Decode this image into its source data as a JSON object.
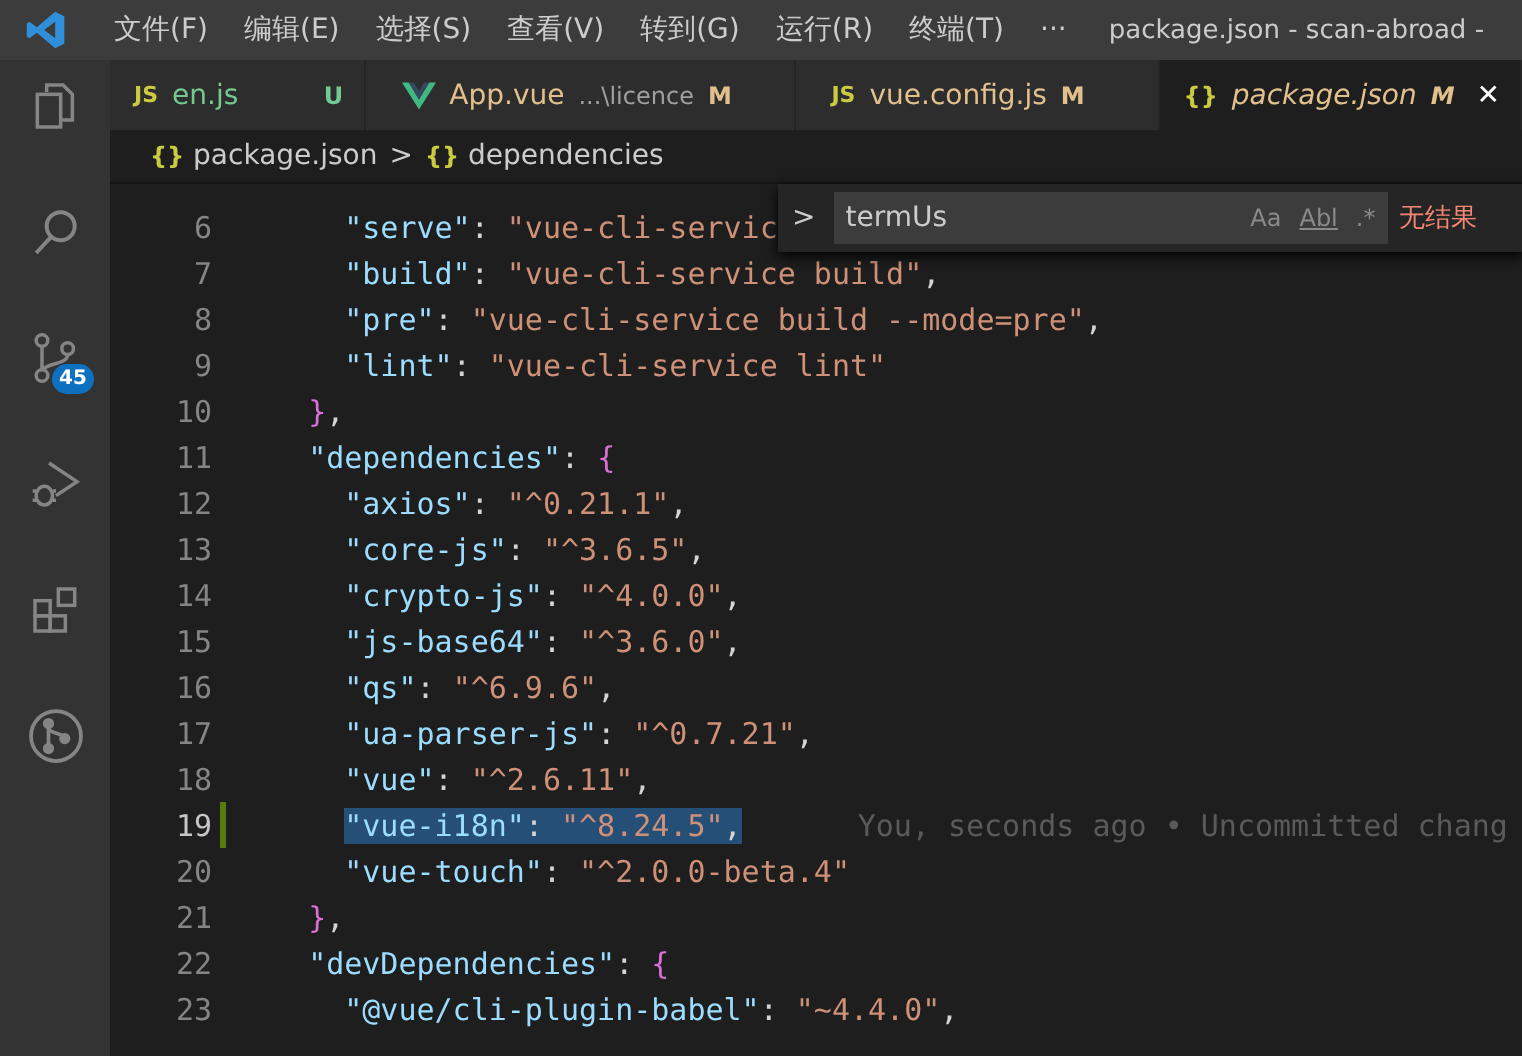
{
  "title_bar": {
    "menus": [
      "文件(F)",
      "编辑(E)",
      "选择(S)",
      "查看(V)",
      "转到(G)",
      "运行(R)",
      "终端(T)"
    ],
    "more": "···",
    "title": "package.json - scan-abroad -"
  },
  "activity_bar": [
    {
      "kind": "explorer",
      "selected": false
    },
    {
      "kind": "search",
      "selected": false
    },
    {
      "kind": "source-control",
      "selected": false,
      "badge": "45"
    },
    {
      "kind": "debug",
      "selected": false
    },
    {
      "kind": "extensions",
      "selected": false
    },
    {
      "kind": "git-graph",
      "selected": false
    }
  ],
  "tabs": [
    {
      "kind": "js",
      "icon": "JS",
      "label": "en.js",
      "status": "U",
      "selected": false
    },
    {
      "kind": "vue",
      "label": "App.vue",
      "detail": "...\\licence",
      "status": "M",
      "selected": false
    },
    {
      "kind": "js",
      "icon": "JS",
      "label": "vue.config.js",
      "status": "M",
      "selected": false
    },
    {
      "kind": "json",
      "icon": "{}",
      "label": "package.json",
      "status": "M",
      "close": "✕",
      "selected": true
    }
  ],
  "breadcrumb": [
    {
      "icon": "{}",
      "label": "package.json"
    },
    {
      "icon": "{}",
      "label": "dependencies"
    }
  ],
  "breadcrumb_separator": ">",
  "find_widget": {
    "toggle": ">",
    "value": "termUs",
    "options": [
      "Aa",
      "Abl",
      ".*"
    ],
    "result": "无结果"
  },
  "lines": [
    {
      "number": "6",
      "modified": false,
      "current": false,
      "selected": false,
      "tokens": [
        {
          "kind": "key",
          "text": "    \"serve\""
        },
        {
          "kind": "punct",
          "text": ": "
        },
        {
          "kind": "str",
          "text": "\"vue-cli-servic"
        }
      ]
    },
    {
      "number": "7",
      "modified": false,
      "current": false,
      "selected": false,
      "tokens": [
        {
          "kind": "key",
          "text": "    \"build\""
        },
        {
          "kind": "punct",
          "text": ": "
        },
        {
          "kind": "str",
          "text": "\"vue-cli-service build\""
        },
        {
          "kind": "punct",
          "text": ","
        }
      ]
    },
    {
      "number": "8",
      "modified": false,
      "current": false,
      "selected": false,
      "tokens": [
        {
          "kind": "key",
          "text": "    \"pre\""
        },
        {
          "kind": "punct",
          "text": ": "
        },
        {
          "kind": "str",
          "text": "\"vue-cli-service build --mode=pre\""
        },
        {
          "kind": "punct",
          "text": ","
        }
      ]
    },
    {
      "number": "9",
      "modified": false,
      "current": false,
      "selected": false,
      "tokens": [
        {
          "kind": "key",
          "text": "    \"lint\""
        },
        {
          "kind": "punct",
          "text": ": "
        },
        {
          "kind": "str",
          "text": "\"vue-cli-service lint\""
        }
      ]
    },
    {
      "number": "10",
      "modified": false,
      "current": false,
      "selected": false,
      "tokens": [
        {
          "kind": "bracket",
          "text": "  }"
        },
        {
          "kind": "punct",
          "text": ","
        }
      ]
    },
    {
      "number": "11",
      "modified": false,
      "current": false,
      "selected": false,
      "tokens": [
        {
          "kind": "key",
          "text": "  \"dependencies\""
        },
        {
          "kind": "punct",
          "text": ": "
        },
        {
          "kind": "bracket",
          "text": "{"
        }
      ]
    },
    {
      "number": "12",
      "modified": false,
      "current": false,
      "selected": false,
      "tokens": [
        {
          "kind": "key",
          "text": "    \"axios\""
        },
        {
          "kind": "punct",
          "text": ": "
        },
        {
          "kind": "str",
          "text": "\"^0.21.1\""
        },
        {
          "kind": "punct",
          "text": ","
        }
      ]
    },
    {
      "number": "13",
      "modified": false,
      "current": false,
      "selected": false,
      "tokens": [
        {
          "kind": "key",
          "text": "    \"core-js\""
        },
        {
          "kind": "punct",
          "text": ": "
        },
        {
          "kind": "str",
          "text": "\"^3.6.5\""
        },
        {
          "kind": "punct",
          "text": ","
        }
      ]
    },
    {
      "number": "14",
      "modified": false,
      "current": false,
      "selected": false,
      "tokens": [
        {
          "kind": "key",
          "text": "    \"crypto-js\""
        },
        {
          "kind": "punct",
          "text": ": "
        },
        {
          "kind": "str",
          "text": "\"^4.0.0\""
        },
        {
          "kind": "punct",
          "text": ","
        }
      ]
    },
    {
      "number": "15",
      "modified": false,
      "current": false,
      "selected": false,
      "tokens": [
        {
          "kind": "key",
          "text": "    \"js-base64\""
        },
        {
          "kind": "punct",
          "text": ": "
        },
        {
          "kind": "str",
          "text": "\"^3.6.0\""
        },
        {
          "kind": "punct",
          "text": ","
        }
      ]
    },
    {
      "number": "16",
      "modified": false,
      "current": false,
      "selected": false,
      "tokens": [
        {
          "kind": "key",
          "text": "    \"qs\""
        },
        {
          "kind": "punct",
          "text": ": "
        },
        {
          "kind": "str",
          "text": "\"^6.9.6\""
        },
        {
          "kind": "punct",
          "text": ","
        }
      ]
    },
    {
      "number": "17",
      "modified": false,
      "current": false,
      "selected": false,
      "tokens": [
        {
          "kind": "key",
          "text": "    \"ua-parser-js\""
        },
        {
          "kind": "punct",
          "text": ": "
        },
        {
          "kind": "str",
          "text": "\"^0.7.21\""
        },
        {
          "kind": "punct",
          "text": ","
        }
      ]
    },
    {
      "number": "18",
      "modified": false,
      "current": false,
      "selected": false,
      "tokens": [
        {
          "kind": "key",
          "text": "    \"vue\""
        },
        {
          "kind": "punct",
          "text": ": "
        },
        {
          "kind": "str",
          "text": "\"^2.6.11\""
        },
        {
          "kind": "punct",
          "text": ","
        }
      ]
    },
    {
      "number": "19",
      "modified": true,
      "current": true,
      "blame": "You, seconds ago • Uncommitted chang",
      "selected": true,
      "tokens": [
        {
          "kind": "key",
          "text": "    \"vue-i18n\""
        },
        {
          "kind": "punct",
          "text": ": "
        },
        {
          "kind": "str",
          "text": "\"^8.24.5\""
        },
        {
          "kind": "punct",
          "text": ","
        }
      ]
    },
    {
      "number": "20",
      "modified": false,
      "current": false,
      "selected": false,
      "tokens": [
        {
          "kind": "key",
          "text": "    \"vue-touch\""
        },
        {
          "kind": "punct",
          "text": ": "
        },
        {
          "kind": "str",
          "text": "\"^2.0.0-beta.4\""
        }
      ]
    },
    {
      "number": "21",
      "modified": false,
      "current": false,
      "selected": false,
      "tokens": [
        {
          "kind": "bracket",
          "text": "  }"
        },
        {
          "kind": "punct",
          "text": ","
        }
      ]
    },
    {
      "number": "22",
      "modified": false,
      "current": false,
      "selected": false,
      "tokens": [
        {
          "kind": "key",
          "text": "  \"devDependencies\""
        },
        {
          "kind": "punct",
          "text": ": "
        },
        {
          "kind": "bracket",
          "text": "{"
        }
      ]
    },
    {
      "number": "23",
      "modified": false,
      "current": false,
      "selected": false,
      "tokens": [
        {
          "kind": "key",
          "text": "    \"@vue/cli-plugin-babel\""
        },
        {
          "kind": "punct",
          "text": ": "
        },
        {
          "kind": "str",
          "text": "\"~4.4.0\""
        },
        {
          "kind": "punct",
          "text": ","
        }
      ]
    }
  ]
}
